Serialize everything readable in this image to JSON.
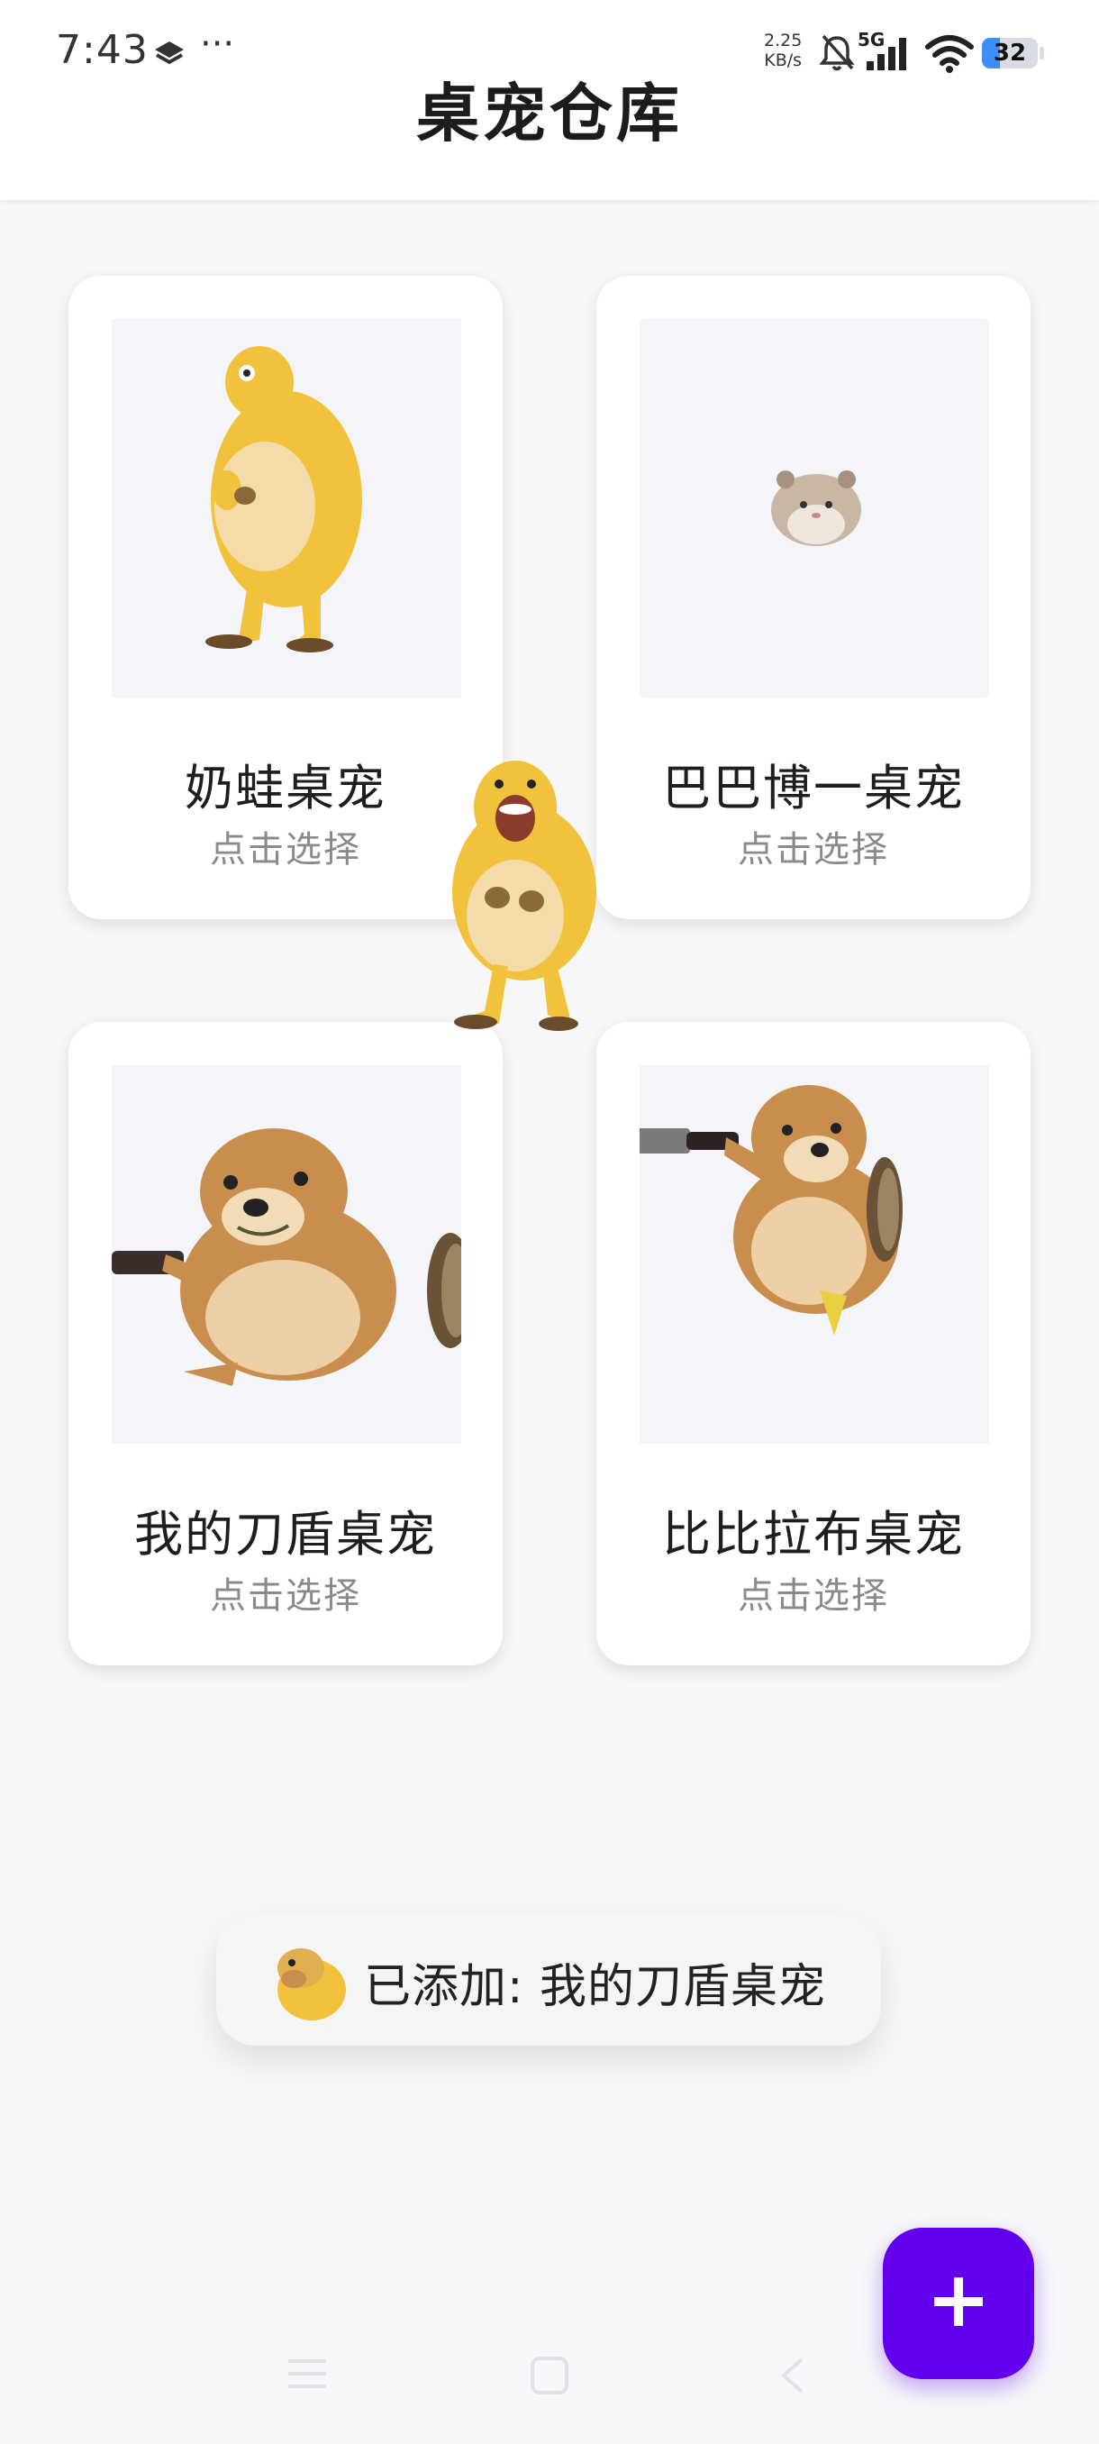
{
  "status_bar": {
    "time": "7:43",
    "more": "···",
    "net_speed_value": "2.25",
    "net_speed_unit": "KB/s",
    "network_type": "5G",
    "battery": "32",
    "battery_level": 0.32
  },
  "header": {
    "title": "桌宠仓库"
  },
  "cards": [
    {
      "name": "奶蛙桌宠",
      "action": "点击选择"
    },
    {
      "name": "巴巴博一桌宠",
      "action": "点击选择"
    },
    {
      "name": "我的刀盾桌宠",
      "action": "点击选择"
    },
    {
      "name": "比比拉布桌宠",
      "action": "点击选择"
    }
  ],
  "toast": {
    "text": "已添加: 我的刀盾桌宠"
  },
  "fab": {
    "label": "+"
  },
  "colors": {
    "accent": "#6200ee",
    "battery": "#3d8ef8",
    "pet_yellow": "#f2c23c",
    "dog_brown": "#c98d4e"
  }
}
